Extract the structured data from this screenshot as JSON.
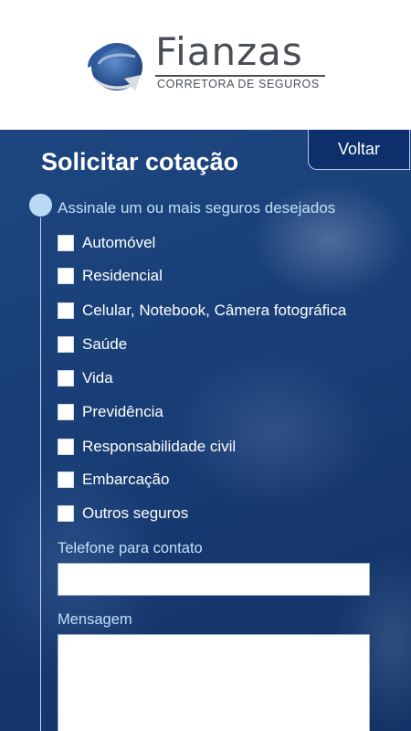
{
  "brand": {
    "name": "Fianzas",
    "tagline": "CORRETORA DE SEGUROS"
  },
  "page": {
    "title": "Solicitar cotação",
    "back_label": "Voltar"
  },
  "form": {
    "instruction": "Assinale um ou mais seguros desejados",
    "options": [
      {
        "label": "Automóvel",
        "checked": false
      },
      {
        "label": "Residencial",
        "checked": false
      },
      {
        "label": "Celular, Notebook, Câmera fotográfica",
        "checked": false
      },
      {
        "label": "Saúde",
        "checked": false
      },
      {
        "label": "Vida",
        "checked": false
      },
      {
        "label": "Previdência",
        "checked": false
      },
      {
        "label": "Responsabilidade civil",
        "checked": false
      },
      {
        "label": "Embarcação",
        "checked": false
      },
      {
        "label": "Outros seguros",
        "checked": false
      }
    ],
    "phone_label": "Telefone para contato",
    "phone_value": "",
    "message_label": "Mensagem",
    "message_value": ""
  },
  "colors": {
    "primary": "#16386f",
    "accent": "#bfe0f8",
    "brand_gray": "#4a4f57"
  }
}
